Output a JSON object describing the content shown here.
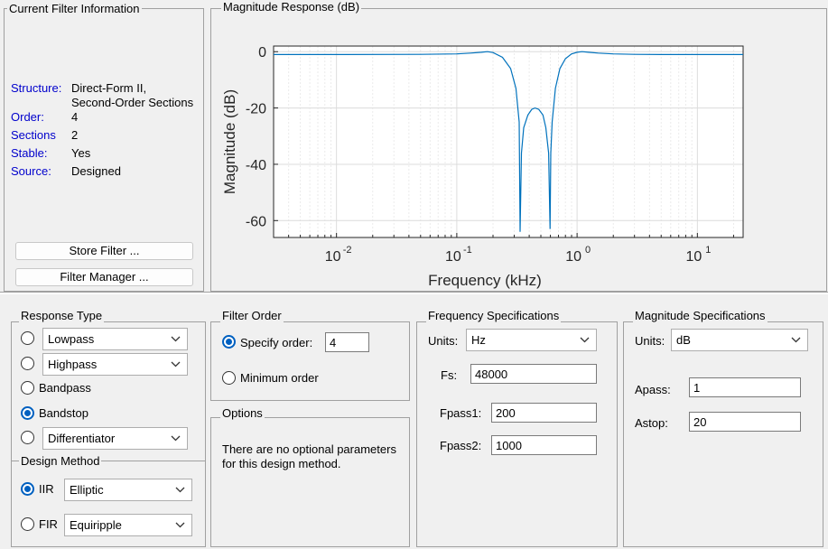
{
  "current_filter": {
    "title": "Current Filter Information",
    "structure_label": "Structure:",
    "structure_value_line1": "Direct-Form II,",
    "structure_value_line2": "Second-Order Sections",
    "order_label": "Order:",
    "order_value": "4",
    "sections_label": "Sections",
    "sections_value": "2",
    "stable_label": "Stable:",
    "stable_value": "Yes",
    "source_label": "Source:",
    "source_value": "Designed",
    "store_button": "Store Filter ...",
    "manager_button": "Filter Manager ..."
  },
  "magnitude_panel": {
    "title": "Magnitude Response (dB)"
  },
  "chart_data": {
    "type": "line",
    "title": "",
    "xlabel": "Frequency (kHz)",
    "ylabel": "Magnitude (dB)",
    "x_scale": "log",
    "xlim": [
      0.003,
      24
    ],
    "ylim": [
      -66,
      2
    ],
    "x_ticks": [
      0.01,
      0.1,
      1,
      10
    ],
    "x_tick_labels": [
      {
        "base": "10",
        "exp": "-2"
      },
      {
        "base": "10",
        "exp": "-1"
      },
      {
        "base": "10",
        "exp": "0"
      },
      {
        "base": "10",
        "exp": "1"
      }
    ],
    "y_ticks": [
      0,
      -20,
      -40,
      -60
    ],
    "y_tick_labels": [
      "0",
      "-20",
      "-40",
      "-60"
    ],
    "grid": true,
    "line_color": "#0072bd",
    "series": [
      {
        "x": [
          0.003,
          0.01,
          0.05,
          0.1,
          0.13,
          0.16,
          0.18,
          0.2,
          0.24,
          0.28,
          0.31,
          0.33,
          0.336,
          0.345,
          0.36,
          0.39,
          0.42,
          0.447,
          0.48,
          0.52,
          0.55,
          0.58,
          0.596,
          0.605,
          0.62,
          0.66,
          0.72,
          0.8,
          0.9,
          1.0,
          1.1,
          1.25,
          1.5,
          2.0,
          3.0,
          5.0,
          10.0,
          24.0
        ],
        "y": [
          -1,
          -1,
          -0.95,
          -0.8,
          -0.5,
          -0.2,
          0,
          -0.3,
          -2,
          -6,
          -13,
          -25,
          -64,
          -36,
          -27,
          -22.5,
          -20.5,
          -20,
          -20.5,
          -22.5,
          -27,
          -36,
          -63,
          -36,
          -25,
          -13,
          -6,
          -2.5,
          -0.8,
          -0.2,
          0,
          -0.2,
          -0.5,
          -0.8,
          -0.95,
          -1,
          -1,
          -1
        ]
      }
    ]
  },
  "response_type": {
    "title": "Response Type",
    "lowpass": "Lowpass",
    "highpass": "Highpass",
    "bandpass": "Bandpass",
    "bandstop": "Bandstop",
    "differentiator": "Differentiator"
  },
  "design_method": {
    "title": "Design Method",
    "iir_label": "IIR",
    "iir_value": "Elliptic",
    "fir_label": "FIR",
    "fir_value": "Equiripple"
  },
  "filter_order": {
    "title": "Filter Order",
    "specify_label": "Specify order:",
    "specify_value": "4",
    "minimum_label": "Minimum order"
  },
  "options": {
    "title": "Options",
    "text_line1": "There are no optional parameters",
    "text_line2": "for this design method."
  },
  "freq_spec": {
    "title": "Frequency Specifications",
    "units_label": "Units:",
    "units_value": "Hz",
    "fs_label": "Fs:",
    "fs_value": "48000",
    "fpass1_label": "Fpass1:",
    "fpass1_value": "200",
    "fpass2_label": "Fpass2:",
    "fpass2_value": "1000"
  },
  "mag_spec": {
    "title": "Magnitude Specifications",
    "units_label": "Units:",
    "units_value": "dB",
    "apass_label": "Apass:",
    "apass_value": "1",
    "astop_label": "Astop:",
    "astop_value": "20"
  }
}
